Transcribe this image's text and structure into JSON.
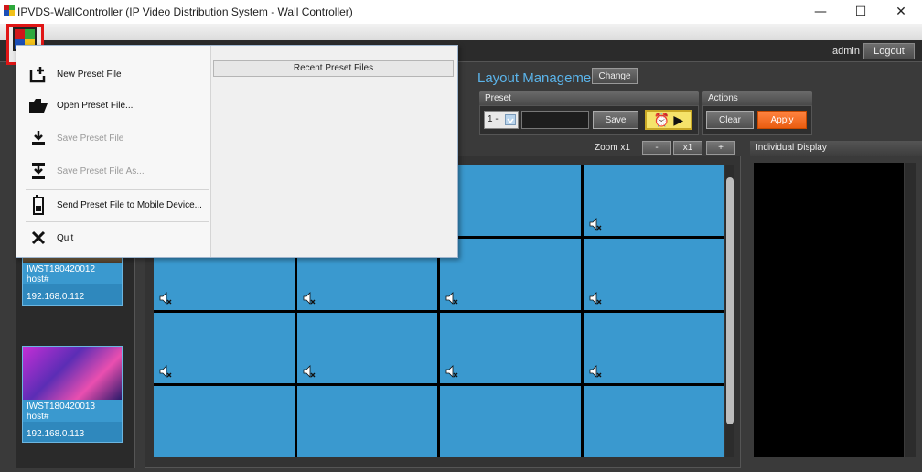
{
  "window": {
    "title": "IPVDS-WallController (IP Video Distribution System - Wall Controller)",
    "minimize": "—",
    "maximize": "☐",
    "close": "✕"
  },
  "topbar": {
    "user": "admin",
    "logout": "Logout"
  },
  "layout": {
    "title": "Layout Management",
    "change": "Change"
  },
  "preset": {
    "header": "Preset",
    "selected": "1 -",
    "save": "Save"
  },
  "actions": {
    "header": "Actions",
    "clear": "Clear",
    "apply": "Apply"
  },
  "zoom": {
    "label": "Zoom x1",
    "minus": "-",
    "x1": "x1",
    "plus": "+"
  },
  "individual_display": {
    "header": "Individual Display"
  },
  "sources": [
    {
      "name": "IWST180420012",
      "host": "host#",
      "ip": "192.168.0.112"
    },
    {
      "name": "IWST180420013",
      "host": "host#",
      "ip": "192.168.0.113"
    }
  ],
  "menu": {
    "recent_header": "Recent Preset Files",
    "items": [
      {
        "label": "New Preset File",
        "icon": "new-file-icon",
        "enabled": true
      },
      {
        "label": "Open Preset File...",
        "icon": "open-folder-icon",
        "enabled": true
      },
      {
        "label": "Save Preset File",
        "icon": "save-icon",
        "enabled": false
      },
      {
        "label": "Save Preset File As...",
        "icon": "save-as-icon",
        "enabled": false
      },
      {
        "label": "Send Preset File to Mobile Device...",
        "icon": "mobile-device-icon",
        "enabled": true
      },
      {
        "label": "Quit",
        "icon": "close-x-icon",
        "enabled": true
      }
    ]
  },
  "colors": {
    "cell": "#3a99cf",
    "highlight": "#e01616",
    "apply": "#ea5d10",
    "title_accent": "#5bb4ea"
  }
}
